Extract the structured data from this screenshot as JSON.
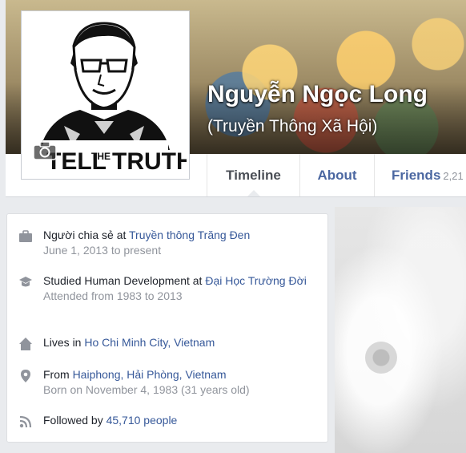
{
  "profile": {
    "name": "Nguyễn Ngọc Long",
    "alternate_name": "(Truyền Thông Xã Hội)",
    "picture_text_1": "TELL",
    "picture_text_2": "THE",
    "picture_text_3": "TRUTH"
  },
  "tabs": [
    {
      "label": "Timeline",
      "active": true
    },
    {
      "label": "About"
    },
    {
      "label": "Friends",
      "count": "2,21"
    }
  ],
  "intro": {
    "work": {
      "icon": "briefcase-icon",
      "prefix": "Người chia sẻ at ",
      "link": "Truyền thông Trăng Đen",
      "sub": "June 1, 2013 to present"
    },
    "education": {
      "icon": "graduation-cap-icon",
      "prefix": "Studied Human Development at ",
      "link": "Đại Học Trường Đời",
      "sub": "Attended from 1983 to 2013"
    },
    "lives": {
      "icon": "home-icon",
      "prefix": "Lives in ",
      "link": "Ho Chi Minh City, Vietnam"
    },
    "from": {
      "icon": "location-pin-icon",
      "prefix": "From ",
      "link": "Haiphong, Hải Phòng, Vietnam",
      "sub": "Born on November 4, 1983 (31 years old)"
    },
    "followers": {
      "icon": "rss-icon",
      "prefix": "Followed by ",
      "link": "45,710 people"
    }
  },
  "colors": {
    "link": "#365899",
    "text": "#1d2129",
    "muted": "#90949c",
    "tab": "#4b67a1"
  }
}
